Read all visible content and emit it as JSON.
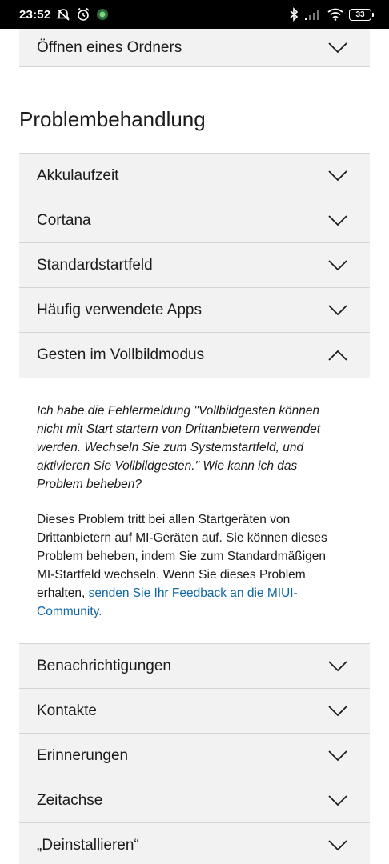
{
  "status_bar": {
    "time": "23:52",
    "battery": "33",
    "icons": [
      "mute-icon",
      "alarm-icon",
      "app-notification-icon",
      "bluetooth-icon",
      "signal-icon",
      "wifi-icon",
      "battery-icon"
    ]
  },
  "top_item": {
    "label": "Öffnen eines Ordners",
    "expanded": false
  },
  "section": {
    "title": "Problembehandlung",
    "items_before": [
      {
        "label": "Akkulaufzeit"
      },
      {
        "label": "Cortana"
      },
      {
        "label": "Standardstartfeld"
      },
      {
        "label": "Häufig verwendete Apps"
      }
    ],
    "expanded_item": {
      "label": "Gesten im Vollbildmodus",
      "question": "Ich habe die Fehlermeldung \"Vollbildgesten können nicht mit Start startern von Drittanbietern verwendet werden. Wechseln Sie zum Systemstartfeld, und aktivieren Sie Vollbildgesten.\" Wie kann ich das Problem beheben?",
      "answer_text": "Dieses Problem tritt bei allen Startgeräten von Drittanbietern auf MI-Geräten auf. Sie können dieses Problem beheben, indem Sie zum Standardmäßigen MI-Startfeld wechseln. Wenn Sie dieses Problem erhalten, ",
      "answer_link": "senden Sie Ihr Feedback an die MIUI-Community."
    },
    "items_after": [
      {
        "label": "Benachrichtigungen"
      },
      {
        "label": "Kontakte"
      },
      {
        "label": "Erinnerungen"
      },
      {
        "label": "Zeitachse"
      },
      {
        "label": "„Deinstallieren“"
      }
    ]
  },
  "colors": {
    "link": "#0f67a8",
    "item_bg": "#f2f2f2",
    "divider": "#d4d4d4",
    "status_bar": "#000000"
  }
}
